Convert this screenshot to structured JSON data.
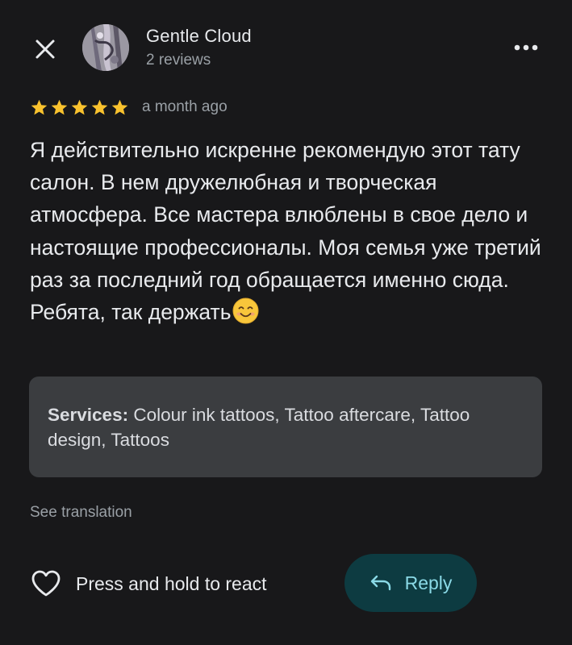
{
  "header": {
    "close_icon": "close-icon",
    "author_name": "Gentle Cloud",
    "author_meta": "2 reviews",
    "more_icon": "more-vert-icon"
  },
  "review": {
    "rating": 5,
    "rating_max": 5,
    "star_color": "#f9c22e",
    "time_ago": "a month ago",
    "text": "Я действительно искренне рекомендую этот тату салон. В нем дружелюбная и творческая атмосфера. Все мастера влюблены в свое дело и настоящие профессионалы. Моя семья уже третий раз за последний год обращается именно сюда. Ребята, так держать",
    "emoji": "smiling-face-emoji"
  },
  "services": {
    "label": "Services:",
    "value": "Colour ink tattoos, Tattoo aftercare, Tattoo design, Tattoos"
  },
  "see_translation": "See translation",
  "actions": {
    "react_label": "Press and hold to react",
    "react_icon": "heart-icon",
    "reply_label": "Reply",
    "reply_icon": "reply-arrow-icon",
    "reply_bg": "#0d3b41",
    "reply_text_color": "#8ad9e6"
  }
}
